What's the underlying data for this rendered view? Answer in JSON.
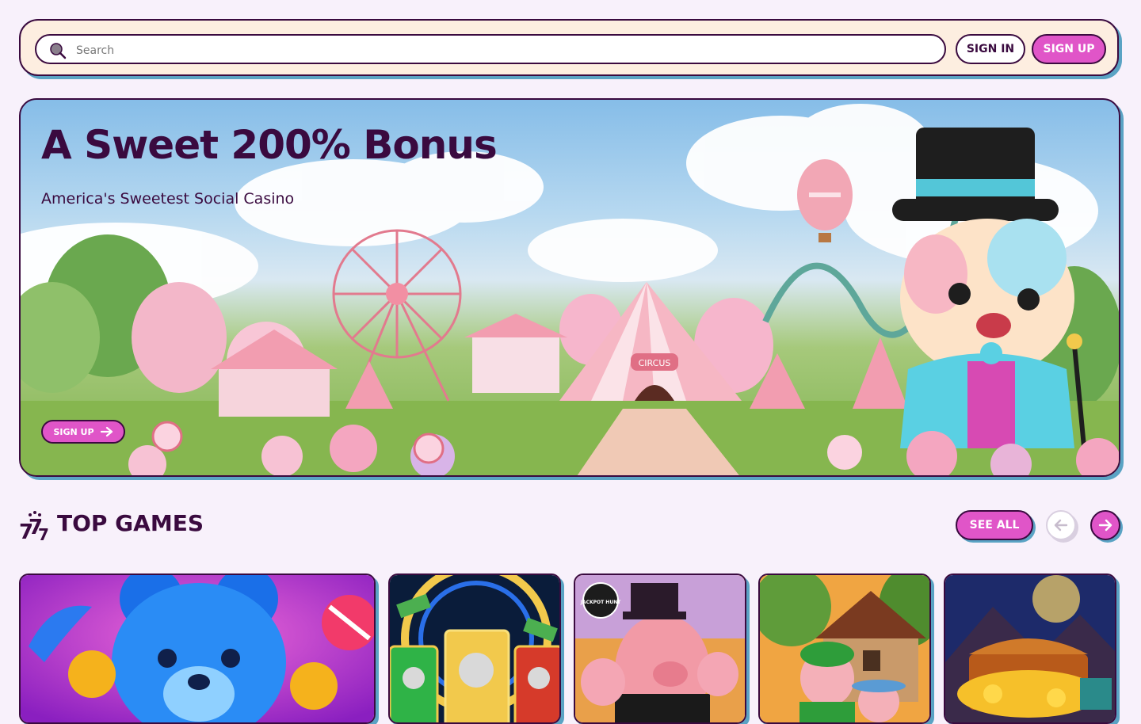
{
  "header": {
    "search_placeholder": "Search",
    "sign_in": "SIGN IN",
    "sign_up": "SIGN UP"
  },
  "hero": {
    "title": "A Sweet 200% Bonus",
    "subtitle": "America's Sweetest Social Casino",
    "cta": "SIGN UP",
    "tent_sign": "CIRCUS"
  },
  "top_games": {
    "title": "TOP GAMES",
    "see_all": "SEE ALL",
    "games": [
      {
        "badge": ""
      },
      {
        "badge": ""
      },
      {
        "badge": "JACKPOT HUNT"
      },
      {
        "badge": ""
      },
      {
        "badge": ""
      }
    ]
  },
  "colors": {
    "brand_pink": "#e055c8",
    "dark_plum": "#3a0a3f",
    "shadow_blue": "#5aa3c4",
    "page_bg": "#f8f1fb",
    "header_bg": "#fdeee0"
  },
  "icons": [
    "search-icon",
    "arrow-right-icon",
    "sevens-icon",
    "arrow-left-icon"
  ]
}
